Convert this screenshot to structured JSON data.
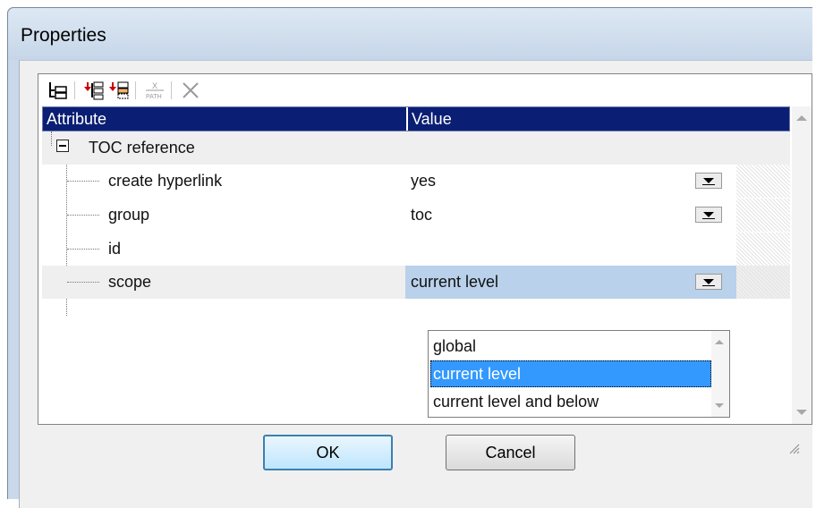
{
  "window": {
    "title": "Properties"
  },
  "toolbar": {
    "icons": [
      "tree-icon",
      "insert-before-icon",
      "append-child-icon",
      "xpath-icon",
      "delete-icon"
    ],
    "xpath_text": "PATH"
  },
  "grid": {
    "headers": {
      "attribute": "Attribute",
      "value": "Value"
    },
    "group": {
      "label": "TOC reference",
      "expander": "⊟"
    },
    "rows": [
      {
        "label": "create hyperlink",
        "value": "yes"
      },
      {
        "label": "group",
        "value": "toc"
      },
      {
        "label": "id",
        "value": ""
      },
      {
        "label": "scope",
        "value": "current level"
      }
    ]
  },
  "dropdown": {
    "options": [
      "global",
      "current level",
      "current level and below"
    ],
    "selected": "current level"
  },
  "buttons": {
    "ok": "OK",
    "cancel": "Cancel"
  },
  "colors": {
    "header_bg": "#0a1f73",
    "selection": "#3399ff",
    "row_selected": "#b9d1ea"
  }
}
